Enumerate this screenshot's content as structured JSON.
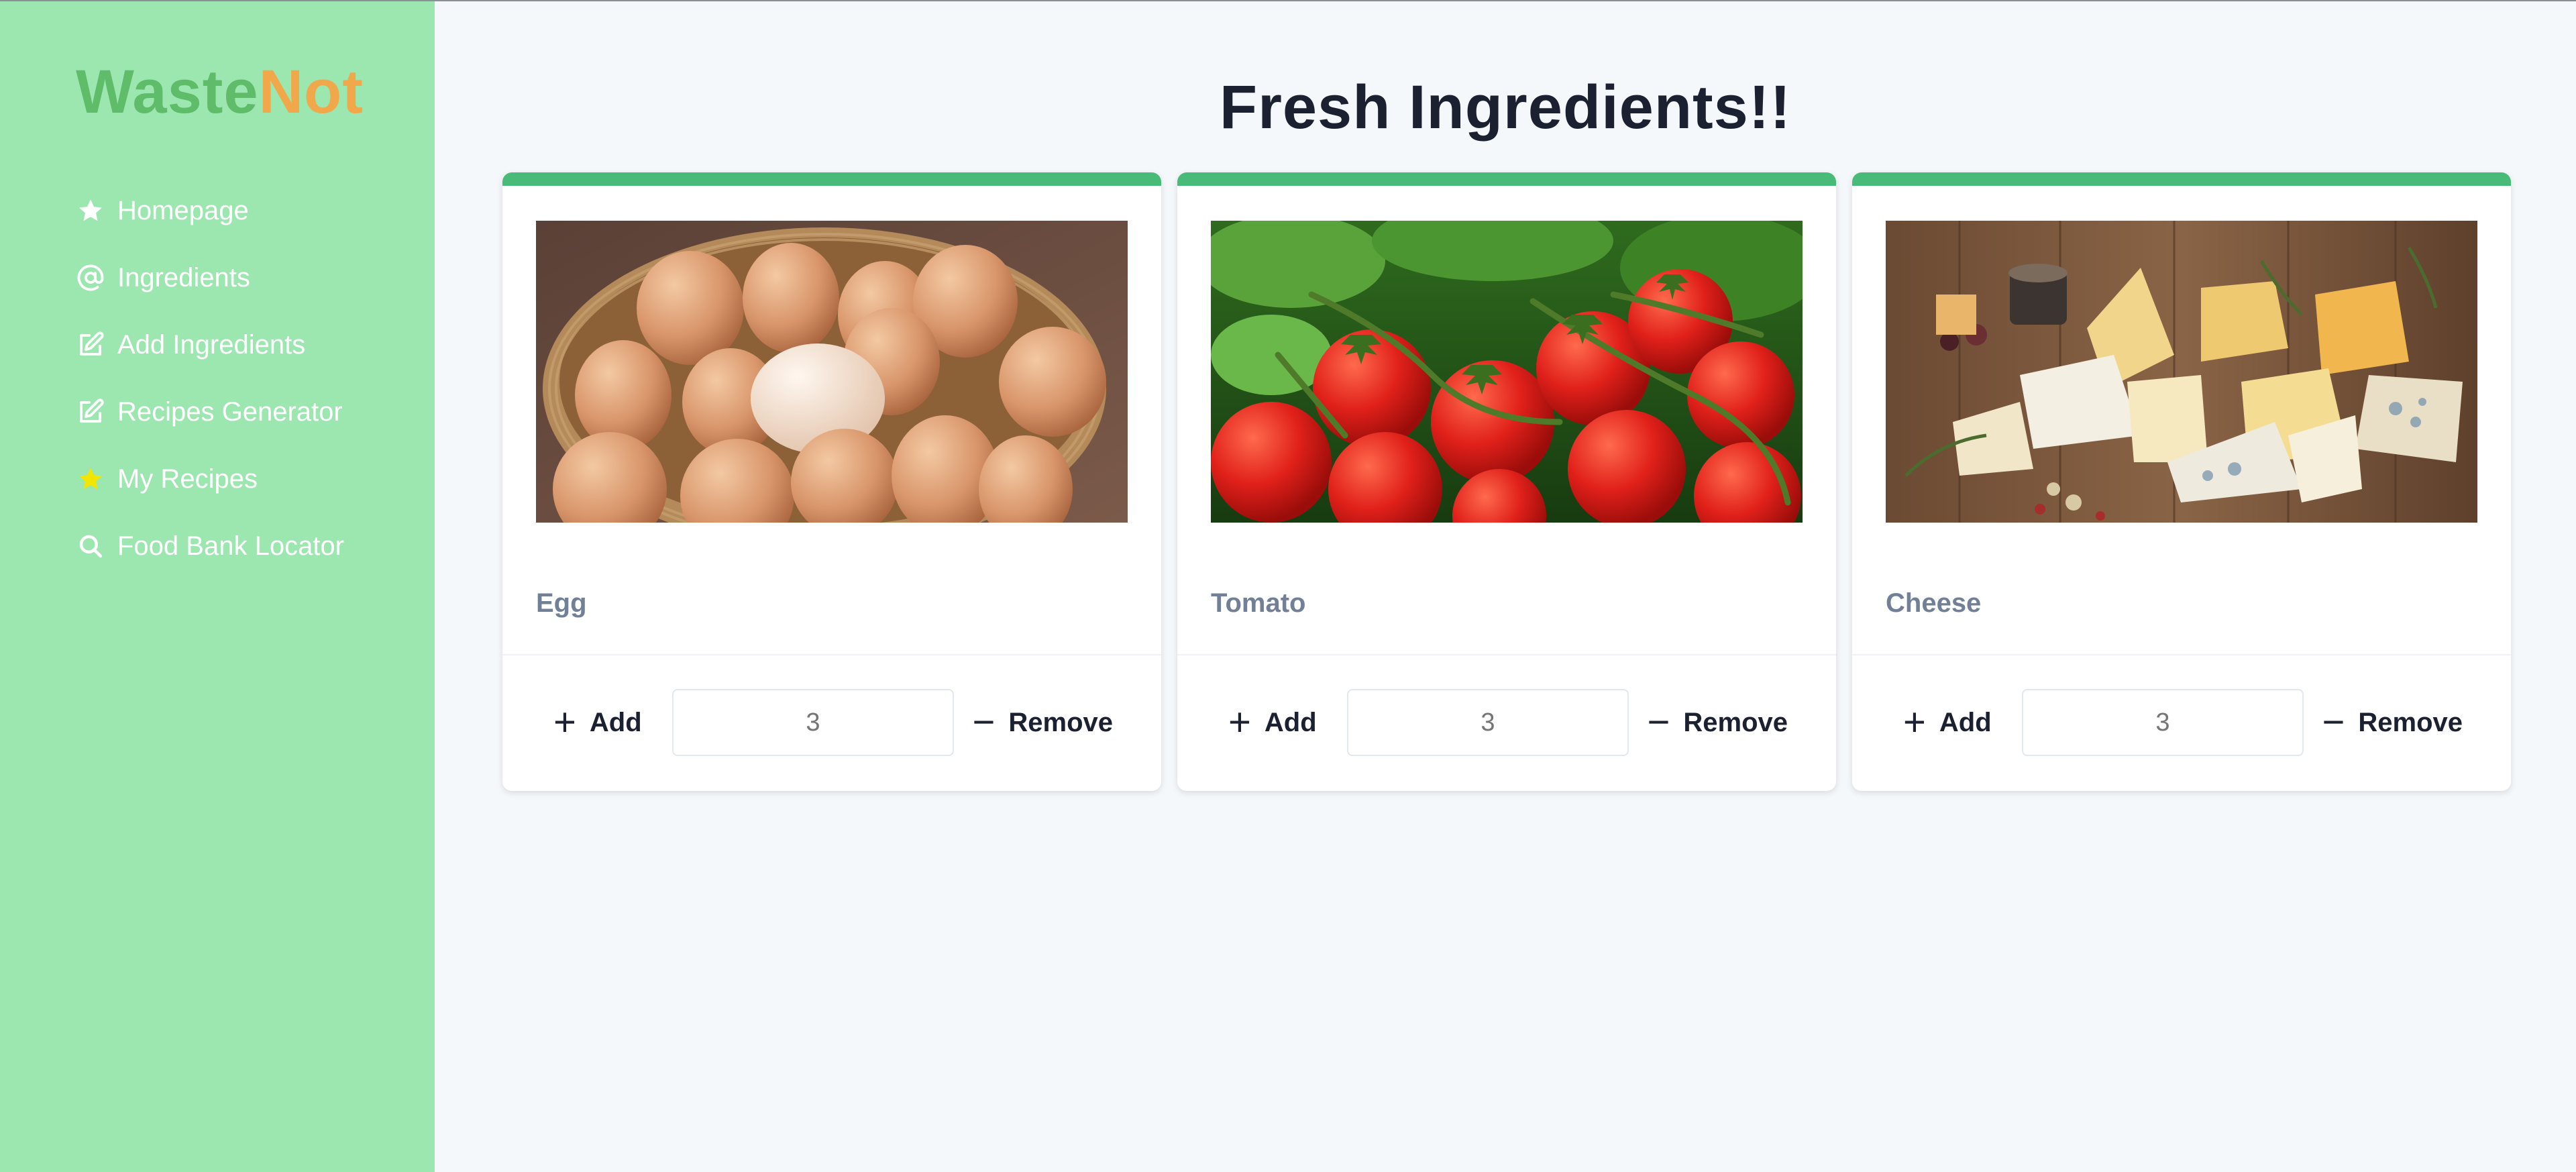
{
  "app": {
    "logo_part1": "Waste",
    "logo_part2": "Not",
    "colors": {
      "sidebar_bg": "#9ce6b0",
      "logo_waste": "#5fbd6a",
      "logo_not": "#f0a84a",
      "card_accent": "#48bb78",
      "page_bg": "#f5f8fb"
    }
  },
  "sidebar": {
    "items": [
      {
        "label": "Homepage",
        "icon": "star-icon"
      },
      {
        "label": "Ingredients",
        "icon": "at-sign-icon"
      },
      {
        "label": "Add Ingredients",
        "icon": "edit-icon"
      },
      {
        "label": "Recipes Generator",
        "icon": "edit-icon"
      },
      {
        "label": "My Recipes",
        "icon": "yellow-star-icon"
      },
      {
        "label": "Food Bank Locator",
        "icon": "search-icon"
      }
    ]
  },
  "main": {
    "title": "Fresh Ingredients!!",
    "cards": [
      {
        "name": "Egg",
        "image": "eggs-in-basket-image",
        "add_label": "Add",
        "remove_label": "Remove",
        "quantity_placeholder": "3"
      },
      {
        "name": "Tomato",
        "image": "tomatoes-on-vine-image",
        "add_label": "Add",
        "remove_label": "Remove",
        "quantity_placeholder": "3"
      },
      {
        "name": "Cheese",
        "image": "cheese-assortment-image",
        "add_label": "Add",
        "remove_label": "Remove",
        "quantity_placeholder": "3"
      }
    ]
  }
}
